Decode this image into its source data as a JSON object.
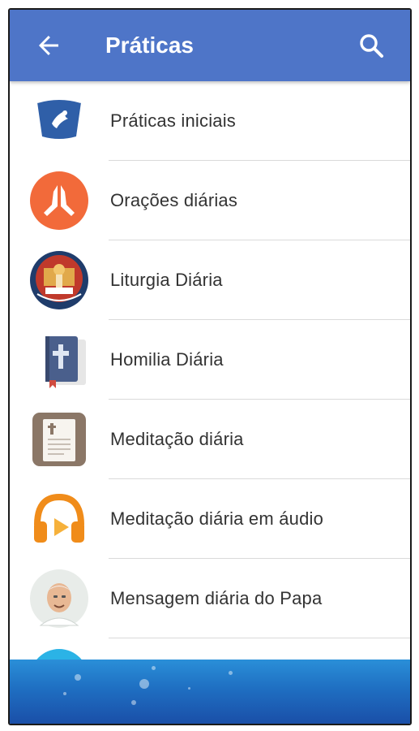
{
  "appbar": {
    "title": "Práticas",
    "back_icon": "arrow-back-icon",
    "search_icon": "search-icon",
    "color": "#4e75c8"
  },
  "items": [
    {
      "label": "Práticas iniciais",
      "icon": "dove-shield-icon"
    },
    {
      "label": "Orações diárias",
      "icon": "praying-hands-icon"
    },
    {
      "label": "Liturgia Diária",
      "icon": "liturgy-icon"
    },
    {
      "label": "Homilia Diária",
      "icon": "bible-icon"
    },
    {
      "label": "Meditação diária",
      "icon": "meditation-card-icon"
    },
    {
      "label": "Meditação diária em áudio",
      "icon": "headphones-icon"
    },
    {
      "label": "Mensagem diária do Papa",
      "icon": "pope-avatar-icon"
    }
  ],
  "banner": {
    "icon": "water-bubbles-banner"
  }
}
